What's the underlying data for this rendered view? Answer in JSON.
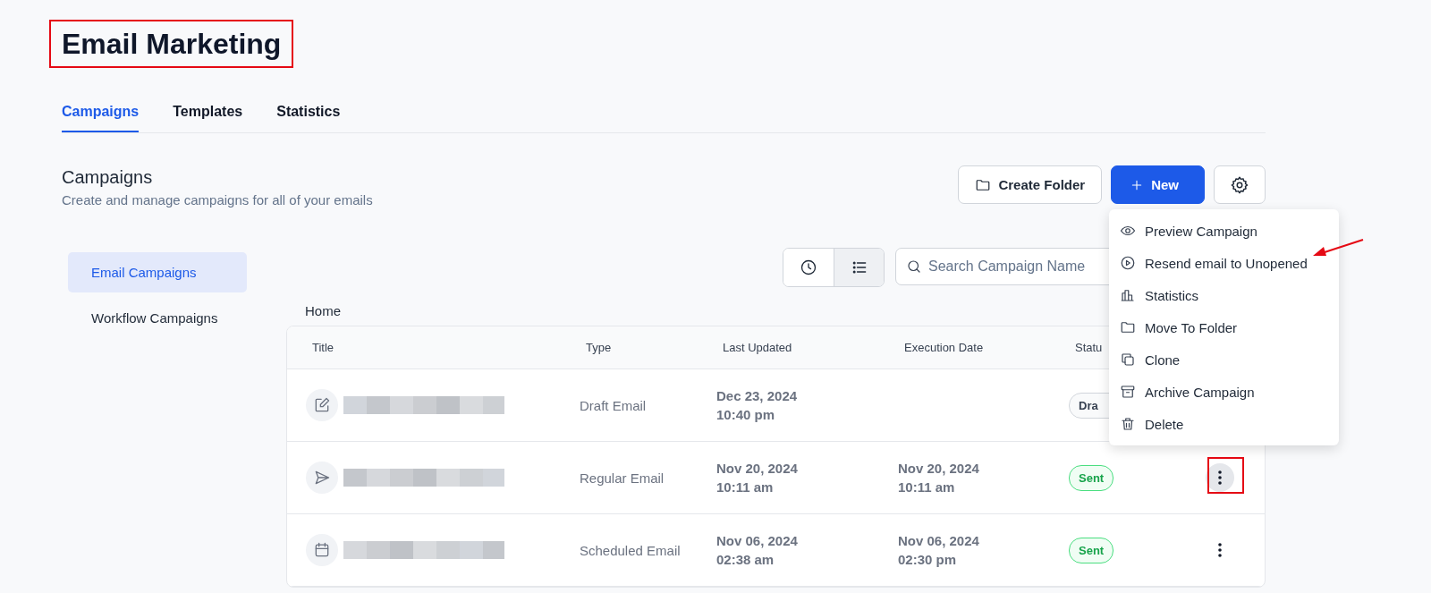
{
  "page_title": "Email Marketing",
  "tabs": [
    {
      "label": "Campaigns",
      "selected": true
    },
    {
      "label": "Templates",
      "selected": false
    },
    {
      "label": "Statistics",
      "selected": false
    }
  ],
  "section": {
    "title": "Campaigns",
    "description": "Create and manage campaigns for all of your emails"
  },
  "buttons": [
    {
      "kind": "folder",
      "label": "Create Folder"
    },
    {
      "kind": "new",
      "label": "New"
    },
    {
      "kind": "settings"
    }
  ],
  "sidebar": {
    "items": [
      {
        "label": "Email Campaigns",
        "selected": true
      },
      {
        "label": "Workflow Campaigns",
        "selected": false
      }
    ]
  },
  "view_toggle": [
    {
      "kind": "clock",
      "selected": false
    },
    {
      "kind": "list",
      "selected": true
    }
  ],
  "search": {
    "placeholder": "Search Campaign Name"
  },
  "breadcrumb": "Home",
  "table": {
    "columns": [
      "Title",
      "Type",
      "Last Updated",
      "Execution Date",
      "Statu"
    ],
    "rows": [
      {
        "kind": "draft",
        "title_redacted": true,
        "type": "Draft Email",
        "last_updated": {
          "date": "Dec 23, 2024",
          "time": "10:40 pm"
        },
        "status": {
          "label": "Dra",
          "kind": "draft"
        }
      },
      {
        "kind": "regular",
        "title_redacted": true,
        "type": "Regular Email",
        "last_updated": {
          "date": "Nov 20, 2024",
          "time": "10:11 am"
        },
        "execution": {
          "date": "Nov 20, 2024",
          "time": "10:11 am"
        },
        "status": {
          "label": "Sent",
          "kind": "sent"
        },
        "actions": {
          "menu_open": true
        }
      },
      {
        "kind": "scheduled",
        "title_redacted": true,
        "type": "Scheduled Email",
        "last_updated": {
          "date": "Nov 06, 2024",
          "time": "02:38 am"
        },
        "execution": {
          "date": "Nov 06, 2024",
          "time": "02:30 pm"
        },
        "status": {
          "label": "Sent",
          "kind": "sent"
        },
        "actions": {
          "menu_open": false
        }
      }
    ]
  },
  "context_menu": [
    {
      "kind": "eye",
      "label": "Preview Campaign"
    },
    {
      "kind": "play",
      "label": "Resend email to Unopened"
    },
    {
      "kind": "chart",
      "label": "Statistics"
    },
    {
      "kind": "folder",
      "label": "Move To Folder"
    },
    {
      "kind": "clone",
      "label": "Clone"
    },
    {
      "kind": "archive",
      "label": "Archive Campaign"
    },
    {
      "kind": "trash",
      "label": "Delete"
    }
  ],
  "annotations": [
    {
      "kind": "box"
    },
    {
      "kind": "box"
    },
    {
      "kind": "arrow"
    }
  ]
}
